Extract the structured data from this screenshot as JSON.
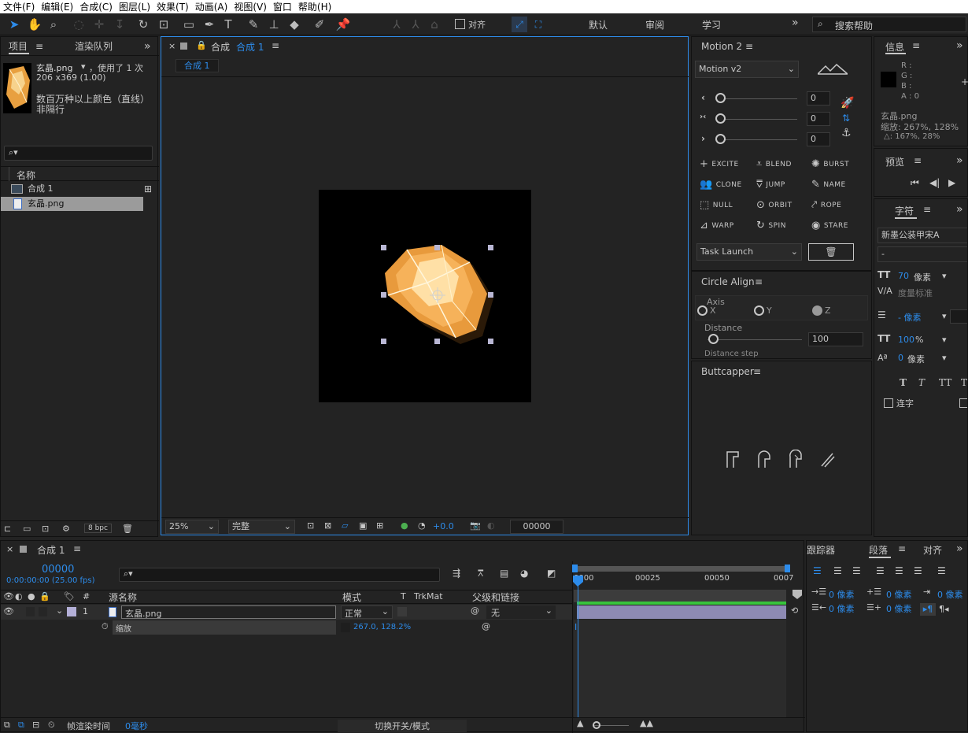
{
  "menu": [
    "文件(F)",
    "编辑(E)",
    "合成(C)",
    "图层(L)",
    "效果(T)",
    "动画(A)",
    "视图(V)",
    "窗口",
    "帮助(H)"
  ],
  "toolbar": {
    "snap_label": "对齐",
    "workspaces": [
      "默认",
      "审阅",
      "学习"
    ],
    "more": "»",
    "search_placeholder": "搜索帮助"
  },
  "project": {
    "tab_project": "项目",
    "tab_render": "渲染队列",
    "file_name": "玄晶.png",
    "used": "，使用了 1 次",
    "dims": "206 x369 (1.00)",
    "colors": "数百万种以上颜色（直线）",
    "interlace": "非隔行",
    "col_name": "名称",
    "items": [
      {
        "name": "合成 1"
      },
      {
        "name": "玄晶.png"
      }
    ],
    "bpc": "8 bpc"
  },
  "comp_viewer": {
    "tab_title": "合成",
    "tab_name": "合成 1",
    "breadcrumb": "合成 1",
    "zoom": "25%",
    "quality": "完整",
    "exposure": "+0.0",
    "timecode": "00000"
  },
  "motion": {
    "title": "Motion 2",
    "version": "Motion v2",
    "sliders": [
      {
        "icon": "‹",
        "value": "0"
      },
      {
        "icon": "›‹",
        "value": "0"
      },
      {
        "icon": "›",
        "value": "0"
      }
    ],
    "buttons": [
      [
        "EXCITE",
        "BLEND",
        "BURST"
      ],
      [
        "CLONE",
        "JUMP",
        "NAME"
      ],
      [
        "NULL",
        "ORBIT",
        "ROPE"
      ],
      [
        "WARP",
        "SPIN",
        "STARE"
      ]
    ],
    "task": "Task Launch"
  },
  "circle_align": {
    "title": "Circle Align",
    "axis_label": "Axis",
    "axes": [
      "X",
      "Y",
      "Z"
    ],
    "distance_label": "Distance",
    "distance_value": "100",
    "distance_step": "Distance step"
  },
  "buttcapper": {
    "title": "Buttcapper"
  },
  "info": {
    "tab": "信息",
    "r": "R :",
    "g": "G :",
    "b": "B :",
    "a": "A : 0",
    "file": "玄晶.png",
    "scale": "缩放: 267%, 128%",
    "delta": "△: 167%, 28%"
  },
  "preview": {
    "tab": "预览"
  },
  "character": {
    "tab": "字符",
    "font": "新墨公装甲宋A",
    "style": "-",
    "size": "70",
    "size_unit": "像素",
    "kerning": "度量标准",
    "leading": "- 像素",
    "vscale": "100",
    "vscale_unit": "%",
    "baseline": "0",
    "baseline_unit": "像素",
    "styles": [
      "T",
      "T",
      "TT",
      "T"
    ],
    "ligature": "连字"
  },
  "timeline": {
    "tab": "合成 1",
    "timecode": "00000",
    "timecode_sub": "0:00:00:00 (25.00 fps)",
    "headers": {
      "source": "源名称",
      "mode": "模式",
      "t": "T",
      "trkmat": "TrkMat",
      "parent": "父级和链接"
    },
    "layer": {
      "num": "1",
      "name": "玄晶.png",
      "mode": "正常",
      "parent": "无"
    },
    "prop": {
      "name": "缩放",
      "value": "267.0, 128.2%"
    },
    "ruler": [
      "0000",
      "00025",
      "00050",
      "0007"
    ],
    "footer_render": "帧渲染时间",
    "footer_time": "0毫秒",
    "toggle": "切换开关/模式"
  },
  "paragraph": {
    "tab_tracker": "跟踪器",
    "tab_paragraph": "段落",
    "tab_align": "对齐",
    "indent_values": [
      "0 像素",
      "0 像素",
      "0 像素",
      "0 像素",
      "0 像素"
    ]
  }
}
